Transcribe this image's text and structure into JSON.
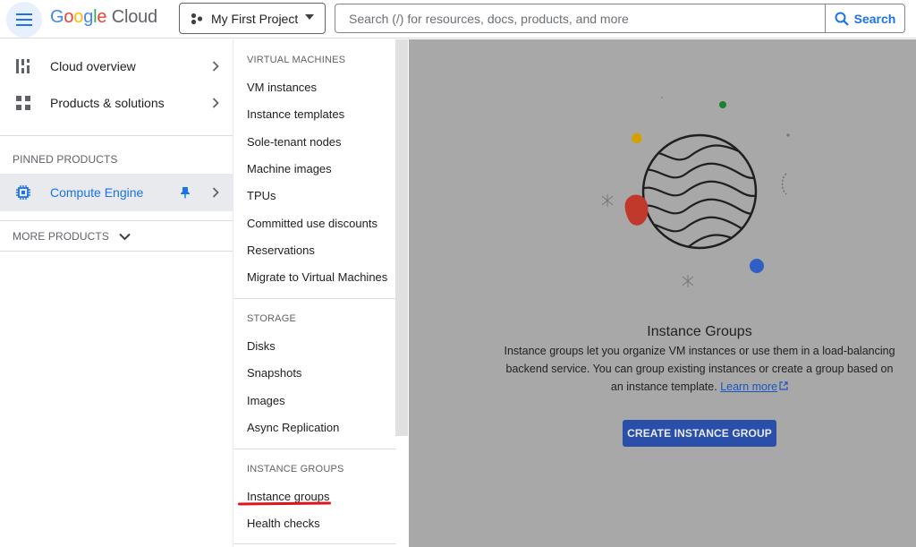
{
  "header": {
    "logo_google": [
      "G",
      "o",
      "o",
      "g",
      "l",
      "e"
    ],
    "logo_cloud": "Cloud",
    "project_label": "My First Project",
    "search_placeholder": "Search (/) for resources, docs, products, and more",
    "search_button": "Search"
  },
  "leftnav": {
    "items": [
      {
        "label": "Cloud overview",
        "icon": "dashboard-icon"
      },
      {
        "label": "Products & solutions",
        "icon": "grid-icon"
      }
    ],
    "pinned_label": "PINNED PRODUCTS",
    "pinned_item": {
      "label": "Compute Engine",
      "icon": "chip-icon"
    },
    "more_products": "MORE PRODUCTS"
  },
  "submenu": {
    "vm_heading": "VIRTUAL MACHINES",
    "vm_items": [
      "VM instances",
      "Instance templates",
      "Sole-tenant nodes",
      "Machine images",
      "TPUs",
      "Committed use discounts",
      "Reservations",
      "Migrate to Virtual Machines"
    ],
    "storage_heading": "STORAGE",
    "storage_items": [
      "Disks",
      "Snapshots",
      "Images",
      "Async Replication"
    ],
    "ig_heading": "INSTANCE GROUPS",
    "ig_items": [
      "Instance groups",
      "Health checks"
    ]
  },
  "main": {
    "title": "Instance Groups",
    "desc_1": "Instance groups let you organize VM instances or use them in a load-balancing backend service. You can group existing instances or create a group based on an instance template.",
    "learn_more": "Learn more",
    "create_button": "CREATE INSTANCE GROUP"
  },
  "colors": {
    "accent": "#1a73e8",
    "overlay": "#a8a8a8",
    "button": "#2a4fa8",
    "annotation": "#e0141b"
  }
}
